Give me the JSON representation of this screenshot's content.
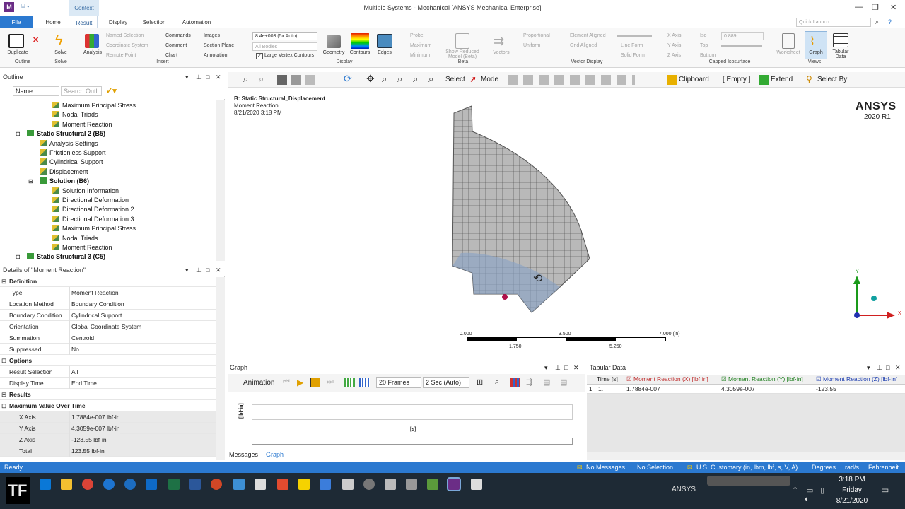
{
  "window": {
    "title": "Multiple Systems - Mechanical [ANSYS Mechanical Enterprise]",
    "context_tab": "Context",
    "app_icon": "M"
  },
  "tabs": [
    "File",
    "Home",
    "Result",
    "Display",
    "Selection",
    "Automation"
  ],
  "quick_launch_placeholder": "Quick Launch",
  "ribbon": {
    "outline": {
      "duplicate": "Duplicate",
      "group": "Outline"
    },
    "solve": {
      "solve": "Solve",
      "group": "Solve"
    },
    "insert": {
      "analysis": "Analysis",
      "named_selection": "Named Selection",
      "coordinate_system": "Coordinate System",
      "remote_point": "Remote Point",
      "commands": "Commands",
      "comment": "Comment",
      "chart": "Chart",
      "images": "Images",
      "section_plane": "Section Plane",
      "annotation": "Annotation",
      "group": "Insert"
    },
    "display": {
      "scale": "8.4e+003 (5x Auto)",
      "bodies": "All Bodies",
      "large_vertex": "Large Vertex Contours",
      "geometry": "Geometry",
      "contours": "Contours",
      "edges": "Edges",
      "group": "Display"
    },
    "beta": {
      "probe": "Probe",
      "maximum": "Maximum",
      "minimum": "Minimum",
      "show_reduced": "Show Reduced Model (Beta)",
      "group": "Beta"
    },
    "vector": {
      "vectors": "Vectors",
      "proportional": "Proportional",
      "uniform": "Uniform",
      "element_aligned": "Element Aligned",
      "grid_aligned": "Grid Aligned",
      "line_form": "Line Form",
      "solid_form": "Solid Form",
      "x_axis": "X Axis",
      "y_axis": "Y Axis",
      "z_axis": "Z Axis",
      "group": "Vector Display"
    },
    "isosurface": {
      "iso": "Iso",
      "top": "Top",
      "bottom": "Bottom",
      "value": "0.889",
      "group": "Capped Isosurface"
    },
    "views": {
      "worksheet": "Worksheet",
      "graph": "Graph",
      "tabular": "Tabular Data",
      "group": "Views"
    }
  },
  "toolbar": {
    "select": "Select",
    "mode": "Mode",
    "clipboard": "Clipboard",
    "empty": "[ Empty ]",
    "extend": "Extend",
    "select_by": "Select By"
  },
  "outline": {
    "title": "Outline",
    "name_filter": "Name",
    "search_placeholder": "Search Outli",
    "items": [
      {
        "label": "Maximum Principal Stress",
        "indent": 3,
        "bold": false
      },
      {
        "label": "Nodal Triads",
        "indent": 3,
        "bold": false
      },
      {
        "label": "Moment Reaction",
        "indent": 3,
        "bold": false
      },
      {
        "label": "Static Structural 2 (B5)",
        "indent": 1,
        "bold": true
      },
      {
        "label": "Analysis Settings",
        "indent": 2,
        "bold": false
      },
      {
        "label": "Frictionless Support",
        "indent": 2,
        "bold": false
      },
      {
        "label": "Cylindrical Support",
        "indent": 2,
        "bold": false
      },
      {
        "label": "Displacement",
        "indent": 2,
        "bold": false
      },
      {
        "label": "Solution (B6)",
        "indent": 2,
        "bold": true
      },
      {
        "label": "Solution Information",
        "indent": 3,
        "bold": false
      },
      {
        "label": "Directional Deformation",
        "indent": 3,
        "bold": false
      },
      {
        "label": "Directional Deformation 2",
        "indent": 3,
        "bold": false
      },
      {
        "label": "Directional Deformation 3",
        "indent": 3,
        "bold": false
      },
      {
        "label": "Maximum Principal Stress",
        "indent": 3,
        "bold": false
      },
      {
        "label": "Nodal Triads",
        "indent": 3,
        "bold": false
      },
      {
        "label": "Moment Reaction",
        "indent": 3,
        "bold": false
      },
      {
        "label": "Static Structural 3 (C5)",
        "indent": 1,
        "bold": true
      }
    ]
  },
  "details": {
    "title": "Details of \"Moment Reaction\"",
    "rows": [
      {
        "k": "Definition",
        "v": "",
        "type": "sec"
      },
      {
        "k": "Type",
        "v": "Moment Reaction",
        "type": "row"
      },
      {
        "k": "Location Method",
        "v": "Boundary Condition",
        "type": "row"
      },
      {
        "k": "Boundary Condition",
        "v": "Cylindrical Support",
        "type": "row"
      },
      {
        "k": "Orientation",
        "v": "Global Coordinate System",
        "type": "row"
      },
      {
        "k": "Summation",
        "v": "Centroid",
        "type": "row"
      },
      {
        "k": "Suppressed",
        "v": "No",
        "type": "row"
      },
      {
        "k": "Options",
        "v": "",
        "type": "sec"
      },
      {
        "k": "Result Selection",
        "v": "All",
        "type": "row"
      },
      {
        "k": "Display Time",
        "v": "End Time",
        "type": "row"
      },
      {
        "k": "Results",
        "v": "",
        "type": "sec"
      },
      {
        "k": "Maximum Value Over Time",
        "v": "",
        "type": "sec"
      },
      {
        "k": "X Axis",
        "v": "1.7884e-007 lbf·in",
        "type": "grey"
      },
      {
        "k": "Y Axis",
        "v": "4.3059e-007 lbf·in",
        "type": "grey"
      },
      {
        "k": "Z Axis",
        "v": "-123.55 lbf·in",
        "type": "grey"
      },
      {
        "k": "Total",
        "v": "123.55 lbf·in",
        "type": "grey"
      }
    ]
  },
  "viewport": {
    "line1": "B: Static Structural_Displacement",
    "line2": "Moment Reaction",
    "line3": "8/21/2020 3:18 PM",
    "brand": "ANSYS",
    "version": "2020 R1",
    "scale_top": [
      "0.000",
      "3.500",
      "7.000 (in)"
    ],
    "scale_bottom": [
      "1.750",
      "5.250"
    ],
    "axis_y": "Y",
    "axis_x": "X"
  },
  "graph": {
    "title": "Graph",
    "animation": "Animation",
    "frames": "20 Frames",
    "duration": "2 Sec (Auto)",
    "ylabel": "[lbf·in]",
    "xlabel": "[s]",
    "tab_messages": "Messages",
    "tab_graph": "Graph"
  },
  "tabular": {
    "title": "Tabular Data",
    "headers": [
      "Time [s]",
      "Moment Reaction (X) [lbf·in]",
      "Moment Reaction (Y) [lbf·in]",
      "Moment Reaction (Z) [lbf·in]"
    ],
    "rows": [
      {
        "idx": "1",
        "time": "1.",
        "x": "1.7884e-007",
        "y": "4.3059e-007",
        "z": "-123.55"
      }
    ]
  },
  "status": {
    "ready": "Ready",
    "messages": "No Messages",
    "selection": "No Selection",
    "units": "U.S. Customary (in, lbm, lbf, s, V, A)",
    "degrees": "Degrees",
    "rads": "rad/s",
    "temp": "Fahrenheit"
  },
  "taskbar": {
    "ansys": "ANSYS",
    "time": "3:18 PM",
    "day": "Friday",
    "date": "8/21/2020"
  }
}
